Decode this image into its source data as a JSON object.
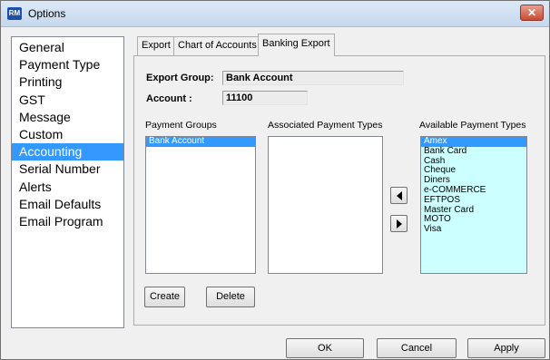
{
  "window": {
    "title": "Options",
    "app_icon_text": "RM",
    "close_glyph": "✕"
  },
  "nav": {
    "items": [
      {
        "label": "General",
        "selected": false
      },
      {
        "label": "Payment Type",
        "selected": false
      },
      {
        "label": "Printing",
        "selected": false
      },
      {
        "label": "GST",
        "selected": false
      },
      {
        "label": "Message",
        "selected": false
      },
      {
        "label": "Custom",
        "selected": false
      },
      {
        "label": "Accounting",
        "selected": true
      },
      {
        "label": "Serial Number",
        "selected": false
      },
      {
        "label": "Alerts",
        "selected": false
      },
      {
        "label": "Email Defaults",
        "selected": false
      },
      {
        "label": "Email Program",
        "selected": false
      }
    ]
  },
  "tabs": [
    {
      "label": "Export",
      "active": false
    },
    {
      "label": "Chart of Accounts",
      "active": false
    },
    {
      "label": "Banking Export",
      "active": true
    }
  ],
  "form": {
    "export_group_label": "Export Group:",
    "export_group_value": "Bank Account",
    "account_label": "Account :",
    "account_value": "11100"
  },
  "columns": {
    "payment_groups_label": "Payment Groups",
    "associated_label": "Associated Payment Types",
    "available_label": "Available Payment Types"
  },
  "payment_groups": [
    {
      "label": "Bank Account",
      "selected": true
    }
  ],
  "associated_payment_types": [],
  "available_payment_types": [
    {
      "label": "Amex",
      "selected": true
    },
    {
      "label": "Bank Card",
      "selected": false
    },
    {
      "label": "Cash",
      "selected": false
    },
    {
      "label": "Cheque",
      "selected": false
    },
    {
      "label": "Diners",
      "selected": false
    },
    {
      "label": "e-COMMERCE",
      "selected": false
    },
    {
      "label": "EFTPOS",
      "selected": false
    },
    {
      "label": "Master Card",
      "selected": false
    },
    {
      "label": "MOTO",
      "selected": false
    },
    {
      "label": "Visa",
      "selected": false
    }
  ],
  "buttons": {
    "create": "Create",
    "delete": "Delete",
    "ok": "OK",
    "cancel": "Cancel",
    "apply": "Apply",
    "move_left_icon": "arrow-left-icon",
    "move_right_icon": "arrow-right-icon"
  },
  "colors": {
    "selection": "#3399ff",
    "available_list_bg": "#ccffff"
  }
}
